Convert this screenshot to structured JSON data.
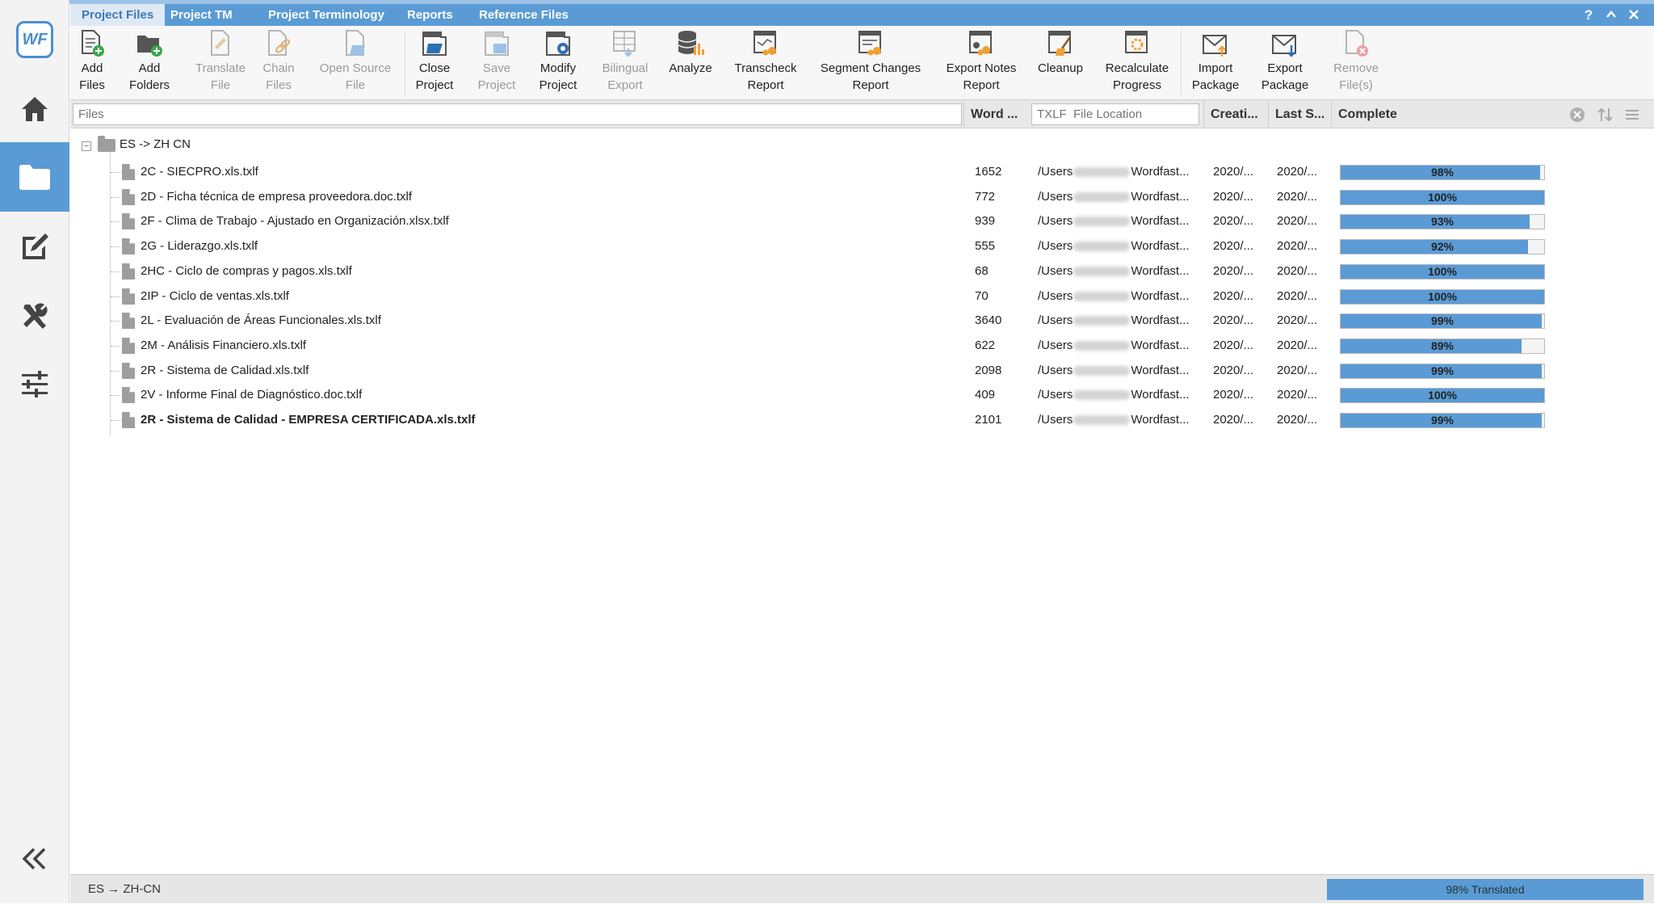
{
  "app": {
    "logo_text": "WF"
  },
  "rail": {
    "items": [
      {
        "icon": "home-icon"
      },
      {
        "icon": "folder-icon",
        "active": true
      },
      {
        "icon": "edit-icon"
      },
      {
        "icon": "tools-icon"
      },
      {
        "icon": "sliders-icon"
      }
    ],
    "collapse_icon": "double-chevron-left-icon"
  },
  "tabs": [
    "Project Files",
    "Project TM",
    "Project Terminology",
    "Reports",
    "Reference Files"
  ],
  "window_buttons": {
    "help": "?",
    "collapse": "⌃",
    "close": "✕"
  },
  "ribbon": {
    "add_files": "Add\nFiles",
    "add_folders": "Add\nFolders",
    "translate_file": "Translate\nFile",
    "chain_files": "Chain\nFiles",
    "open_source_file": "Open Source\nFile",
    "close_project": "Close\nProject",
    "save_project": "Save\nProject",
    "modify_project": "Modify\nProject",
    "bilingual_export": "Bilingual\nExport",
    "analyze": "Analyze",
    "transcheck_report": "Transcheck\nReport",
    "segment_changes_report": "Segment Changes\nReport",
    "export_notes_report": "Export Notes\nReport",
    "cleanup": "Cleanup",
    "recalculate_progress": "Recalculate\nProgress",
    "import_package": "Import\nPackage",
    "export_package": "Export\nPackage",
    "remove_files": "Remove\nFile(s)"
  },
  "columns": {
    "files_placeholder": "Files",
    "word_count": "Word ...",
    "location_placeholder": "TXLF  File Location",
    "created": "Creati...",
    "last_saved": "Last S...",
    "complete": "Complete"
  },
  "group": {
    "label": "ES -> ZH CN"
  },
  "files": [
    {
      "name": "2C - SIECPRO.xls.txlf",
      "words": "1652",
      "loc_prefix": "/Users",
      "loc_suffix": "Wordfast...",
      "created": "2020/...",
      "last": "2020/...",
      "pct_label": "98%",
      "progress": 98
    },
    {
      "name": "2D - Ficha técnica de empresa proveedora.doc.txlf",
      "words": "772",
      "loc_prefix": "/Users",
      "loc_suffix": "Wordfast...",
      "created": "2020/...",
      "last": "2020/...",
      "pct_label": "100%",
      "progress": 100
    },
    {
      "name": "2F - Clima de Trabajo - Ajustado en Organización.xlsx.txlf",
      "words": "939",
      "loc_prefix": "/Users",
      "loc_suffix": "Wordfast...",
      "created": "2020/...",
      "last": "2020/...",
      "pct_label": "93%",
      "progress": 93
    },
    {
      "name": "2G - Liderazgo.xls.txlf",
      "words": "555",
      "loc_prefix": "/Users",
      "loc_suffix": "Wordfast...",
      "created": "2020/...",
      "last": "2020/...",
      "pct_label": "92%",
      "progress": 92
    },
    {
      "name": "2HC - Ciclo de compras y pagos.xls.txlf",
      "words": "68",
      "loc_prefix": "/Users",
      "loc_suffix": "Wordfast...",
      "created": "2020/...",
      "last": "2020/...",
      "pct_label": "100%",
      "progress": 100
    },
    {
      "name": "2IP - Ciclo de ventas.xls.txlf",
      "words": "70",
      "loc_prefix": "/Users",
      "loc_suffix": "Wordfast...",
      "created": "2020/...",
      "last": "2020/...",
      "pct_label": "100%",
      "progress": 100
    },
    {
      "name": "2L - Evaluación de Áreas Funcionales.xls.txlf",
      "words": "3640",
      "loc_prefix": "/Users",
      "loc_suffix": "Wordfast...",
      "created": "2020/...",
      "last": "2020/...",
      "pct_label": "99%",
      "progress": 99
    },
    {
      "name": "2M - Análisis Financiero.xls.txlf",
      "words": "622",
      "loc_prefix": "/Users",
      "loc_suffix": "Wordfast...",
      "created": "2020/...",
      "last": "2020/...",
      "pct_label": "89%",
      "progress": 89
    },
    {
      "name": "2R - Sistema de Calidad.xls.txlf",
      "words": "2098",
      "loc_prefix": "/Users",
      "loc_suffix": "Wordfast...",
      "created": "2020/...",
      "last": "2020/...",
      "pct_label": "99%",
      "progress": 99
    },
    {
      "name": "2V - Informe Final de Diagnóstico.doc.txlf",
      "words": "409",
      "loc_prefix": "/Users",
      "loc_suffix": "Wordfast...",
      "created": "2020/...",
      "last": "2020/...",
      "pct_label": "100%",
      "progress": 100
    },
    {
      "name": "2R - Sistema de Calidad - EMPRESA CERTIFICADA.xls.txlf",
      "words": "2101",
      "loc_prefix": "/Users",
      "loc_suffix": "Wordfast...",
      "created": "2020/...",
      "last": "2020/...",
      "pct_label": "99%",
      "progress": 99,
      "bold": true
    }
  ],
  "status": {
    "language_pair": "ES → ZH-CN",
    "translated": "98% Translated",
    "translated_progress": 98
  },
  "colors": {
    "accent": "#5b9bd5",
    "icon_dark": "#555555",
    "icon_orange": "#f0a030",
    "icon_green": "#3aa64a"
  }
}
